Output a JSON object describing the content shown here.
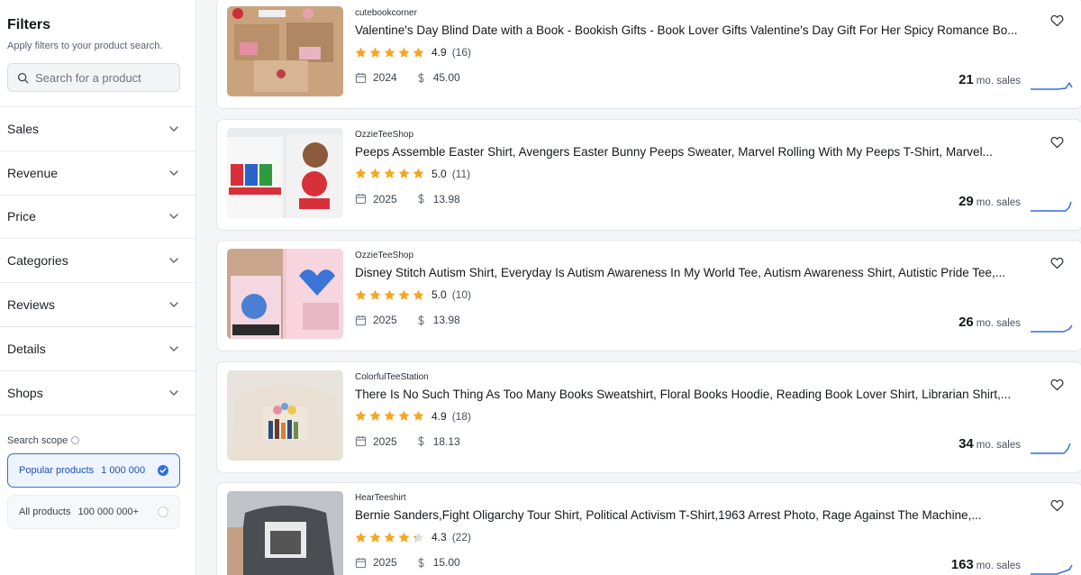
{
  "sidebar": {
    "title": "Filters",
    "subtitle": "Apply filters to your product search.",
    "search_placeholder": "Search for a product",
    "filters": [
      "Sales",
      "Revenue",
      "Price",
      "Categories",
      "Reviews",
      "Details",
      "Shops"
    ],
    "scope_title": "Search scope",
    "scopes": [
      {
        "label": "Popular products",
        "count": "1 000 000",
        "selected": true
      },
      {
        "label": "All products",
        "count": "100 000 000+",
        "selected": false
      }
    ]
  },
  "products": [
    {
      "shop": "cutebookcorner",
      "title": "Valentine's Day Blind Date with a Book - Bookish Gifts - Book Lover Gifts Valentine's Day Gift For Her Spicy Romance Bo...",
      "rating": "4.9",
      "stars": 5,
      "reviews": "(16)",
      "year": "2024",
      "price": "45.00",
      "sales": "21",
      "sales_label": "mo. sales"
    },
    {
      "shop": "OzzieTeeShop",
      "title": "Peeps Assemble Easter Shirt, Avengers Easter Bunny Peeps Sweater, Marvel Rolling With My Peeps T-Shirt, Marvel...",
      "rating": "5.0",
      "stars": 5,
      "reviews": "(11)",
      "year": "2025",
      "price": "13.98",
      "sales": "29",
      "sales_label": "mo. sales"
    },
    {
      "shop": "OzzieTeeShop",
      "title": "Disney Stitch Autism Shirt, Everyday Is Autism Awareness In My World Tee, Autism Awareness Shirt, Autistic Pride Tee,...",
      "rating": "5.0",
      "stars": 5,
      "reviews": "(10)",
      "year": "2025",
      "price": "13.98",
      "sales": "26",
      "sales_label": "mo. sales"
    },
    {
      "shop": "ColorfulTeeStation",
      "title": "There Is No Such Thing As Too Many Books Sweatshirt, Floral Books Hoodie, Reading Book Lover Shirt, Librarian Shirt,...",
      "rating": "4.9",
      "stars": 5,
      "reviews": "(18)",
      "year": "2025",
      "price": "18.13",
      "sales": "34",
      "sales_label": "mo. sales"
    },
    {
      "shop": "HearTeeshirt",
      "title": "Bernie Sanders,Fight Oligarchy Tour Shirt, Political Activism T-Shirt,1963 Arrest Photo, Rage Against The Machine,...",
      "rating": "4.3",
      "stars": 4.3,
      "reviews": "(22)",
      "year": "2025",
      "price": "15.00",
      "sales": "163",
      "sales_label": "mo. sales"
    }
  ],
  "colors": {
    "accent": "#2f6fe0",
    "star": "#f5a623",
    "spark": "#2f6fe0"
  },
  "icons": [
    "search-icon",
    "chevron-down-icon",
    "info-icon",
    "check-icon",
    "heart-icon",
    "calendar-icon",
    "dollar-icon",
    "star-icon",
    "sparkline"
  ]
}
